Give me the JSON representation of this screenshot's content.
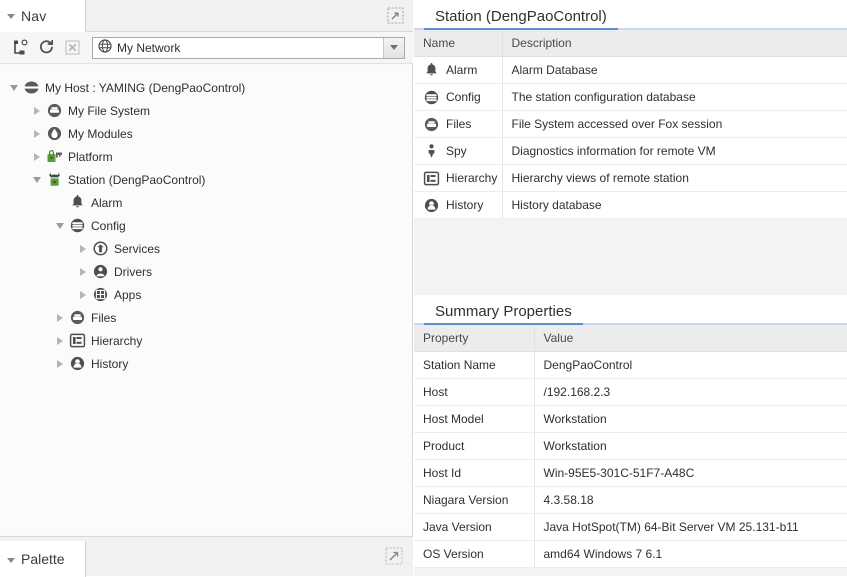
{
  "nav": {
    "tab_label": "Nav",
    "maximize_icon": "maximize-icon",
    "toolbar": {
      "buttons": [
        {
          "name": "new-bookmark-icon",
          "title": "New Bookmark"
        },
        {
          "name": "refresh-icon",
          "title": "Refresh"
        },
        {
          "name": "close-icon",
          "title": "Close"
        }
      ],
      "combo": {
        "icon": "globe-icon",
        "value": "My Network",
        "arrow_icon": "chevron-down-icon"
      }
    },
    "tree": [
      {
        "label": "My Host : YAMING (DengPaoControl)",
        "depth": 0,
        "state": "expanded",
        "icon": "host-icon"
      },
      {
        "label": "My File System",
        "depth": 1,
        "state": "collapsed",
        "icon": "filesystem-icon"
      },
      {
        "label": "My Modules",
        "depth": 1,
        "state": "collapsed",
        "icon": "modules-icon"
      },
      {
        "label": "Platform",
        "depth": 1,
        "state": "collapsed",
        "icon": "platform-icon"
      },
      {
        "label": "Station (DengPaoControl)",
        "depth": 1,
        "state": "expanded",
        "icon": "station-icon"
      },
      {
        "label": "Alarm",
        "depth": 2,
        "state": "leaf",
        "icon": "alarm-bell-icon"
      },
      {
        "label": "Config",
        "depth": 2,
        "state": "expanded",
        "icon": "config-icon"
      },
      {
        "label": "Services",
        "depth": 3,
        "state": "collapsed",
        "icon": "services-icon"
      },
      {
        "label": "Drivers",
        "depth": 3,
        "state": "collapsed",
        "icon": "drivers-icon"
      },
      {
        "label": "Apps",
        "depth": 3,
        "state": "collapsed",
        "icon": "apps-icon"
      },
      {
        "label": "Files",
        "depth": 2,
        "state": "collapsed",
        "icon": "files-icon"
      },
      {
        "label": "Hierarchy",
        "depth": 2,
        "state": "collapsed",
        "icon": "hierarchy-icon"
      },
      {
        "label": "History",
        "depth": 2,
        "state": "collapsed",
        "icon": "history-icon"
      }
    ]
  },
  "palette": {
    "tab_label": "Palette",
    "expand_icon": "expand-icon"
  },
  "station_view": {
    "tab_label": "Station (DengPaoControl)",
    "columns": [
      "Name",
      "Description"
    ],
    "rows": [
      {
        "icon": "alarm-bell-icon",
        "name": "Alarm",
        "description": "Alarm Database"
      },
      {
        "icon": "config-icon",
        "name": "Config",
        "description": "The station configuration database"
      },
      {
        "icon": "files-icon",
        "name": "Files",
        "description": "File System accessed over Fox session"
      },
      {
        "icon": "spy-icon",
        "name": "Spy",
        "description": "Diagnostics information for remote VM"
      },
      {
        "icon": "hierarchy-icon",
        "name": "Hierarchy",
        "description": "Hierarchy views of remote station"
      },
      {
        "icon": "history-icon",
        "name": "History",
        "description": "History database"
      }
    ]
  },
  "summary_view": {
    "tab_label": "Summary Properties",
    "columns": [
      "Property",
      "Value"
    ],
    "rows": [
      {
        "property": "Station Name",
        "value": "DengPaoControl"
      },
      {
        "property": "Host",
        "value": "/192.168.2.3"
      },
      {
        "property": "Host Model",
        "value": "Workstation"
      },
      {
        "property": "Product",
        "value": "Workstation"
      },
      {
        "property": "Host Id",
        "value": "Win-95E5-301C-51F7-A48C"
      },
      {
        "property": "Niagara Version",
        "value": "4.3.58.18"
      },
      {
        "property": "Java Version",
        "value": "Java HotSpot(TM) 64-Bit Server VM 25.131-b11"
      },
      {
        "property": "OS Version",
        "value": "amd64 Windows 7 6.1"
      }
    ]
  },
  "colors": {
    "tab_underline": "#5b8fd0",
    "header_bg": "#ececec",
    "panel_bg": "#f3f3f3",
    "platform_green": "#5a9b3c"
  }
}
